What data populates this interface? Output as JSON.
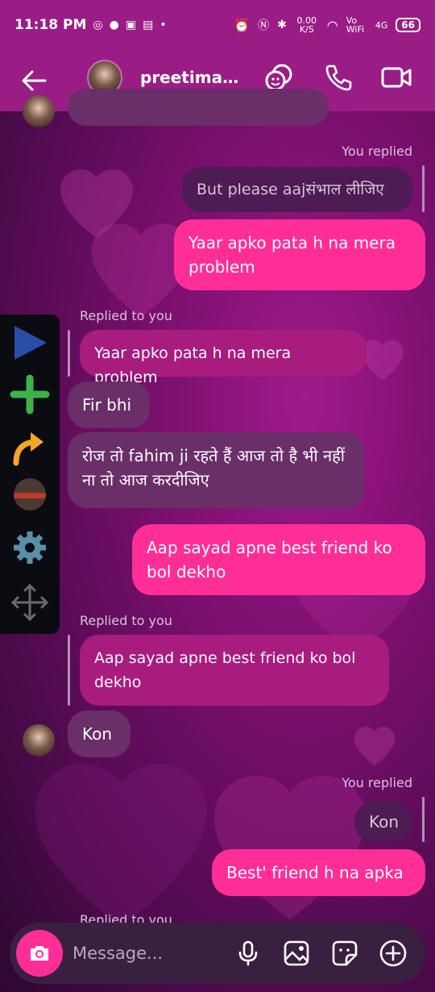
{
  "status_bar": {
    "time": "11:18 PM",
    "net_speed": "0.00 K/S",
    "volte": "Vo WiFi",
    "signal": "4G",
    "battery": "66"
  },
  "header": {
    "contact_name": "preetimaur..."
  },
  "messages": {
    "you_replied_1": "You replied",
    "quoted_out_1": "But  please   aajसंभाल लीजिए",
    "out_1": "Yaar apko pata h na mera problem",
    "replied_to_you_1": "Replied to you",
    "quoted_in_1": "Yaar apko pata h na mera problem",
    "in_1": "Fir bhi",
    "in_2": "रोज तो fahim ji रहते हैं आज तो है भी नहीं ना तो आज करदीजिए",
    "out_2": "Aap sayad apne best friend ko bol dekho",
    "replied_to_you_2": "Replied to you",
    "quoted_in_2": "Aap sayad apne best friend ko bol dekho",
    "in_3": "Kon",
    "you_replied_2": "You replied",
    "quoted_out_2": "Kon",
    "out_3": "Best' friend h na apka",
    "replied_to_you_3": "Replied to you"
  },
  "composer": {
    "placeholder": "Message..."
  },
  "colors": {
    "header_bg": "#9a1d86",
    "outgoing": "#ff2e96",
    "incoming": "#6a2e68"
  },
  "icons": {
    "header": [
      "back-arrow-icon",
      "sticker-group-icon",
      "phone-icon",
      "video-call-icon"
    ],
    "floatbar": [
      "play-icon",
      "plus-icon",
      "redo-arrow-icon",
      "avatar-icon",
      "gear-icon",
      "move-icon"
    ],
    "composer": [
      "camera-icon",
      "microphone-icon",
      "gallery-icon",
      "sticker-icon",
      "add-icon"
    ]
  }
}
